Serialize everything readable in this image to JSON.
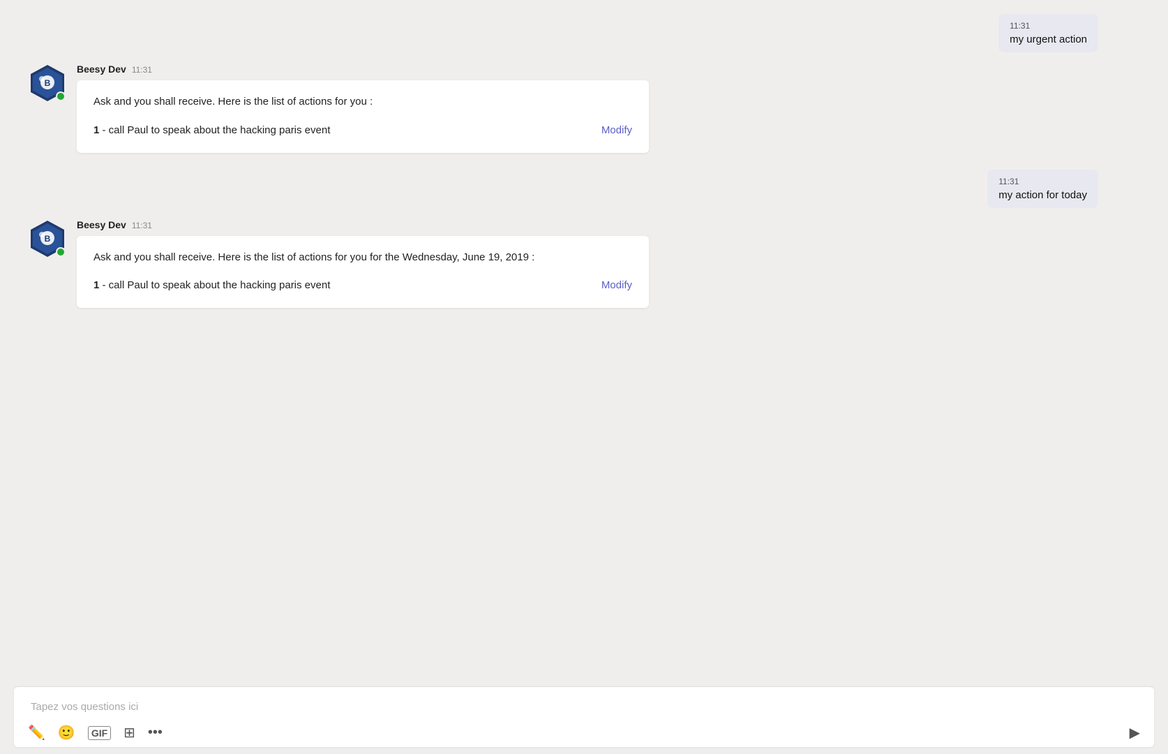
{
  "messages": [
    {
      "id": "msg1",
      "type": "outgoing",
      "time": "11:31",
      "text": "my urgent action"
    },
    {
      "id": "msg2",
      "type": "incoming",
      "sender": "Beesy Dev",
      "time": "11:31",
      "card": {
        "intro": "Ask and you shall receive. Here is the list of actions for you :",
        "actions": [
          {
            "number": "1",
            "text": "- call Paul to speak about the hacking paris event",
            "modify_label": "Modify"
          }
        ]
      }
    },
    {
      "id": "msg3",
      "type": "outgoing",
      "time": "11:31",
      "text": "my action for today"
    },
    {
      "id": "msg4",
      "type": "incoming",
      "sender": "Beesy Dev",
      "time": "11:31",
      "card": {
        "intro": "Ask and you shall receive. Here is the list of actions for you for the Wednesday, June 19, 2019 :",
        "actions": [
          {
            "number": "1",
            "text": "- call Paul to speak about the hacking paris event",
            "modify_label": "Modify"
          }
        ]
      }
    }
  ],
  "input": {
    "placeholder": "Tapez vos questions ici"
  },
  "toolbar": {
    "pen_icon": "✏",
    "emoji_icon": "☺",
    "gif_icon": "GIF",
    "sticker_icon": "⊞",
    "more_icon": "•••",
    "send_icon": "▷"
  }
}
